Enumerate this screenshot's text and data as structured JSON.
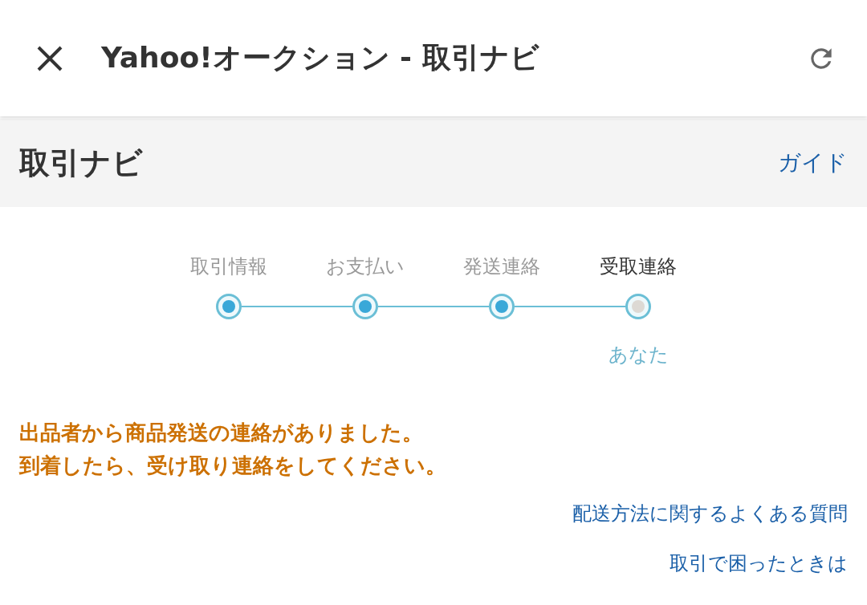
{
  "app_bar": {
    "title": "Yahoo!オークション - 取引ナビ"
  },
  "section": {
    "title": "取引ナビ",
    "guide_link": "ガイド"
  },
  "steps": [
    {
      "label": "取引情報",
      "completed": true,
      "current": false
    },
    {
      "label": "お支払い",
      "completed": true,
      "current": false
    },
    {
      "label": "発送連絡",
      "completed": true,
      "current": false
    },
    {
      "label": "受取連絡",
      "completed": false,
      "current": true,
      "note": "あなた"
    }
  ],
  "message": [
    "出品者から商品発送の連絡がありました。",
    "到着したら、受け取り連絡をしてください。"
  ],
  "links": [
    "配送方法に関するよくある質問",
    "取引で困ったときは"
  ]
}
